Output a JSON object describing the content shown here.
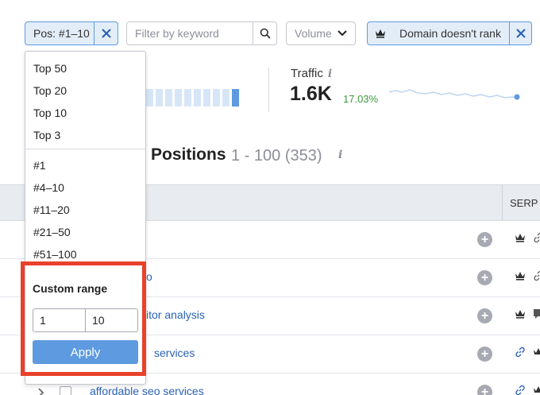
{
  "filters": {
    "position_chip_label": "Pos: #1–10",
    "keyword_filter_placeholder": "Filter by keyword",
    "volume_label": "Volume",
    "domain_chip_label": "Domain doesn't rank"
  },
  "metrics": {
    "traffic_label": "Traffic",
    "info_glyph": "i",
    "traffic_value": "1.6K",
    "traffic_change": "17.03%",
    "accent_color": "#5d9ae0",
    "positive_color": "#3d9a3d"
  },
  "positions": {
    "title": "Positions",
    "range": "1 - 100 (353)"
  },
  "table": {
    "serp_header": "SERP F",
    "rows": [
      {
        "keyword": ""
      },
      {
        "keyword": "o"
      },
      {
        "keyword": "itor analysis"
      },
      {
        "keyword": "services"
      },
      {
        "keyword": "affordable seo services"
      }
    ]
  },
  "dropdown": {
    "top_items": [
      "Top 50",
      "Top 20",
      "Top 10",
      "Top 3"
    ],
    "position_items": [
      "#1",
      "#4–10",
      "#11–20",
      "#21–50",
      "#51–100"
    ],
    "custom_range_title": "Custom range",
    "range_from": "1",
    "range_to": "10",
    "apply_label": "Apply",
    "highlight_color": "#e9412a"
  }
}
